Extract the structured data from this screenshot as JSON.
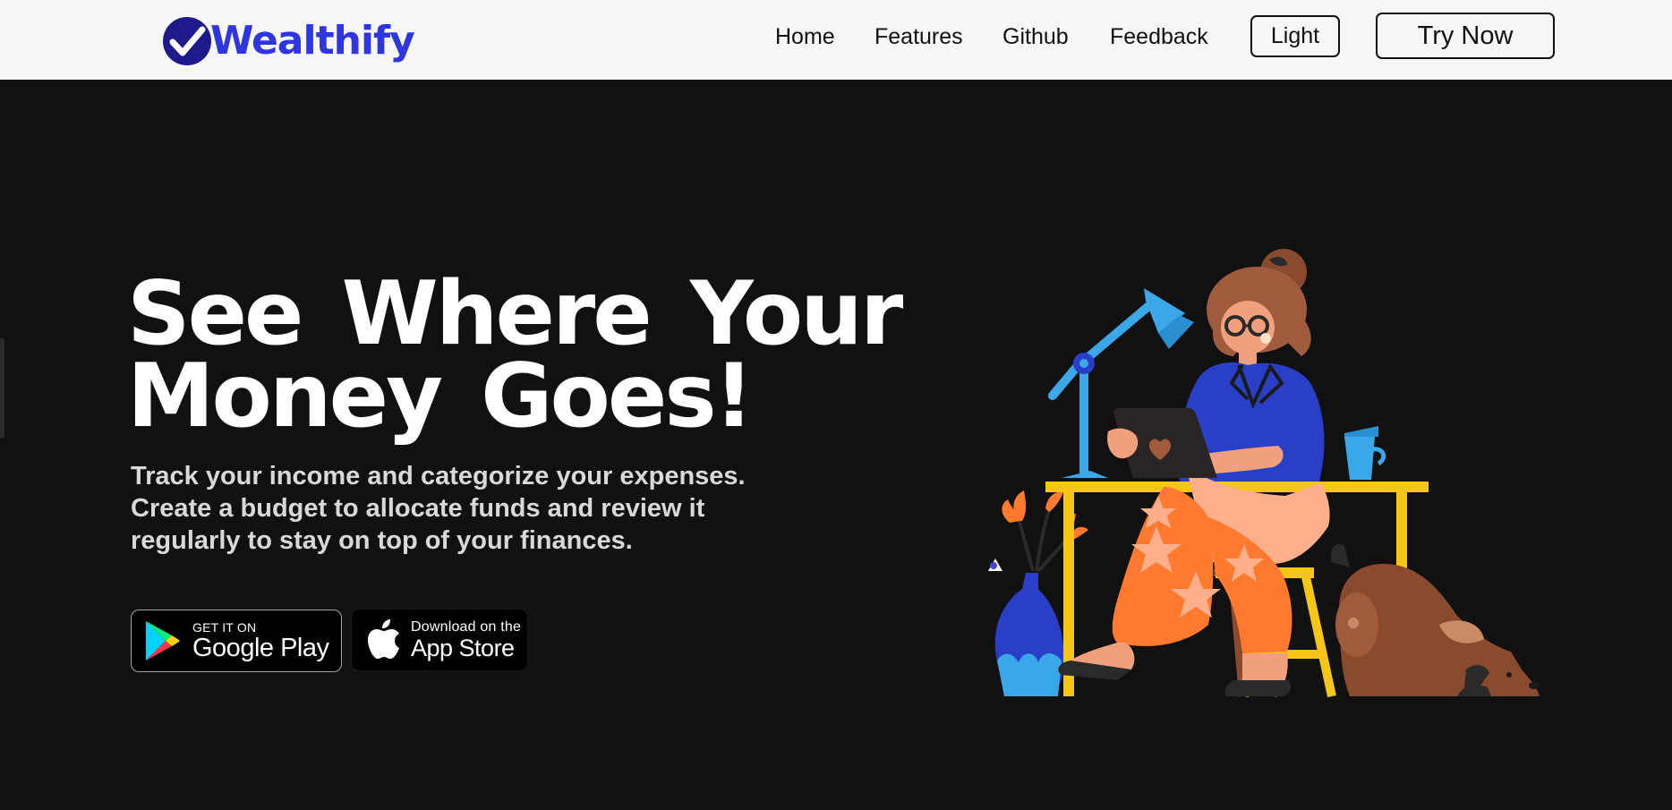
{
  "nav": {
    "brand": "Wealthify",
    "links": [
      "Home",
      "Features",
      "Github",
      "Feedback"
    ],
    "theme_button": "Light",
    "cta_button": "Try Now"
  },
  "hero": {
    "title_line1": "See Where Your",
    "title_line2": "Money Goes!",
    "description": "Track your income and categorize your expenses. Create a budget to allocate funds and review it regularly to stay on top of your finances."
  },
  "stores": {
    "google": {
      "small": "GET IT ON",
      "big": "Google Play"
    },
    "apple": {
      "small": "Download on the",
      "big": "App Store"
    }
  },
  "icons": [
    "checkmark-logo-icon",
    "google-play-icon",
    "apple-icon"
  ],
  "colors": {
    "brand": "#2f35e0",
    "logo_badge": "#1e1a8c",
    "navbar_bg": "#f7f7f7",
    "hero_bg": "#111111",
    "accent_yellow": "#f5c518",
    "accent_orange": "#ff7a2f",
    "accent_blue": "#3aa8e8"
  }
}
